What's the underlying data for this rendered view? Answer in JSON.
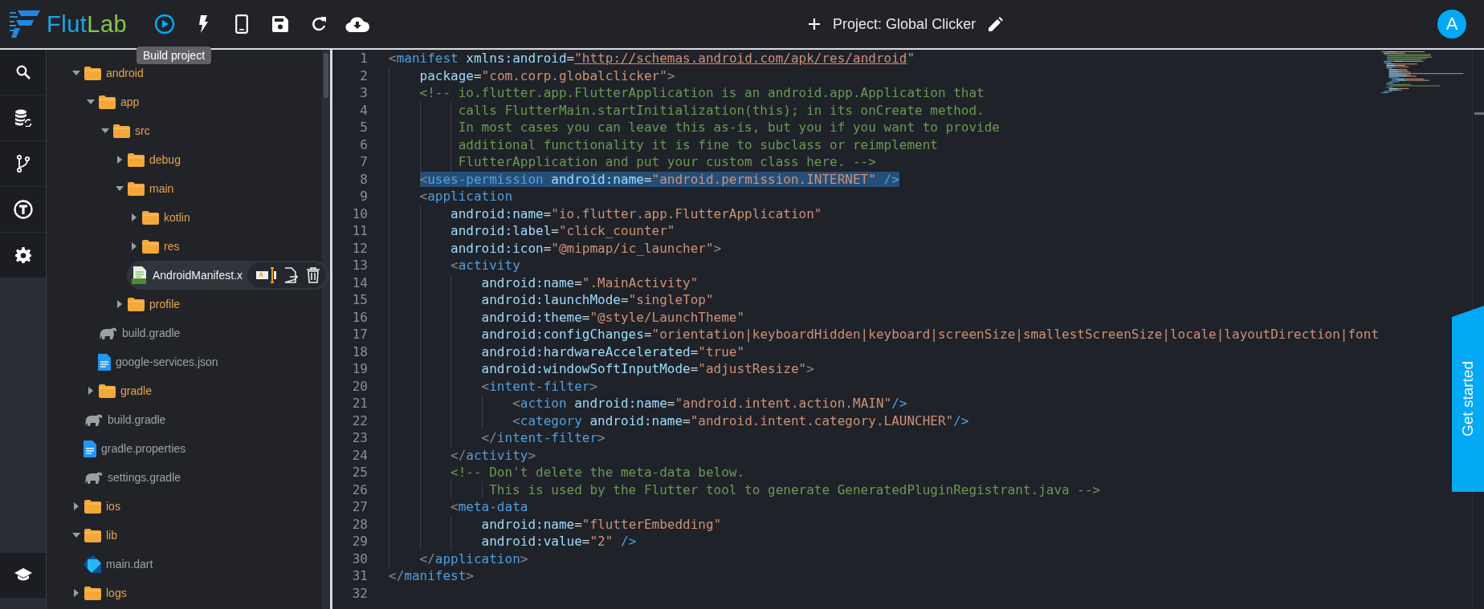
{
  "app": {
    "logo_first": "Flut",
    "logo_second": "Lab",
    "tooltip": "Build project",
    "project_title": "Project: Global Clicker",
    "avatar": "A",
    "get_started": "Get started"
  },
  "toolbar": [
    {
      "kind": "run"
    },
    {
      "kind": "bolt"
    },
    {
      "kind": "phone"
    },
    {
      "kind": "save"
    },
    {
      "kind": "refresh"
    },
    {
      "kind": "cloud"
    }
  ],
  "rail": [
    {
      "kind": "search"
    },
    {
      "kind": "database"
    },
    {
      "kind": "branch"
    },
    {
      "kind": "t"
    },
    {
      "kind": "gear"
    },
    {
      "kind": "school"
    }
  ],
  "tree": [
    {
      "name": "android",
      "kind": "folder",
      "expanded": true,
      "selected": false,
      "children": [
        {
          "name": "app",
          "kind": "folder",
          "expanded": true,
          "selected": false,
          "children": [
            {
              "name": "src",
              "kind": "folder",
              "expanded": true,
              "selected": false,
              "children": [
                {
                  "name": "debug",
                  "kind": "folder",
                  "expanded": false,
                  "selected": false
                },
                {
                  "name": "main",
                  "kind": "folder",
                  "expanded": true,
                  "selected": false,
                  "children": [
                    {
                      "name": "kotlin",
                      "kind": "folder",
                      "expanded": false,
                      "selected": false
                    },
                    {
                      "name": "res",
                      "kind": "folder",
                      "expanded": false,
                      "selected": false
                    },
                    {
                      "name": "AndroidManifest.x",
                      "kind": "xml",
                      "selected": true
                    }
                  ]
                },
                {
                  "name": "profile",
                  "kind": "folder",
                  "expanded": false,
                  "selected": false
                }
              ]
            },
            {
              "name": "build.gradle",
              "kind": "gradle",
              "selected": false
            },
            {
              "name": "google-services.json",
              "kind": "doc",
              "selected": false
            }
          ]
        },
        {
          "name": "gradle",
          "kind": "folder",
          "expanded": false,
          "selected": false
        },
        {
          "name": "build.gradle",
          "kind": "gradle",
          "selected": false
        },
        {
          "name": "gradle.properties",
          "kind": "doc",
          "selected": false
        },
        {
          "name": "settings.gradle",
          "kind": "gradle",
          "selected": false
        }
      ]
    },
    {
      "name": "ios",
      "kind": "folder",
      "expanded": false,
      "selected": false
    },
    {
      "name": "lib",
      "kind": "folder",
      "expanded": true,
      "selected": false,
      "children": [
        {
          "name": "main.dart",
          "kind": "dart",
          "selected": false
        }
      ]
    },
    {
      "name": "logs",
      "kind": "folder",
      "expanded": false,
      "selected": false
    }
  ],
  "editor": {
    "lines": [
      {
        "number": "1",
        "tokens": [
          {
            "kind": "p",
            "text": "<"
          },
          {
            "kind": "tag",
            "text": "manifest "
          },
          {
            "kind": "attr",
            "text": "xmlns:android"
          },
          {
            "kind": "eq",
            "text": "="
          },
          {
            "kind": "link",
            "text": "\"http://schemas.android.com/apk/res/android"
          },
          {
            "kind": "str",
            "text": "\""
          }
        ]
      },
      {
        "number": "2",
        "tokens": [
          {
            "kind": "attr",
            "text": "    package"
          },
          {
            "kind": "eq",
            "text": "="
          },
          {
            "kind": "str",
            "text": "\"com.corp.globalclicker\""
          },
          {
            "kind": "p",
            "text": ">"
          }
        ]
      },
      {
        "number": "3",
        "tokens": [
          {
            "kind": "comment",
            "text": "    <!-- io.flutter.app.FlutterApplication is an android.app.Application that"
          }
        ]
      },
      {
        "number": "4",
        "tokens": [
          {
            "kind": "comment",
            "text": "         calls FlutterMain.startInitialization(this); in its onCreate method."
          }
        ]
      },
      {
        "number": "5",
        "tokens": [
          {
            "kind": "comment",
            "text": "         In most cases you can leave this as-is, but you if you want to provide"
          }
        ]
      },
      {
        "number": "6",
        "tokens": [
          {
            "kind": "comment",
            "text": "         additional functionality it is fine to subclass or reimplement"
          }
        ]
      },
      {
        "number": "7",
        "tokens": [
          {
            "kind": "comment",
            "text": "         FlutterApplication and put your custom class here. -->"
          }
        ]
      },
      {
        "number": "8",
        "highlighted": true,
        "tokens": [
          {
            "kind": "p",
            "text": "    <"
          },
          {
            "kind": "tag",
            "text": "uses-permission "
          },
          {
            "kind": "attr",
            "text": "android:name"
          },
          {
            "kind": "eq",
            "text": "="
          },
          {
            "kind": "str",
            "text": "\"android.permission.INTERNET\""
          },
          {
            "kind": "tag",
            "text": " />"
          }
        ]
      },
      {
        "number": "9",
        "tokens": [
          {
            "kind": "p",
            "text": "    <"
          },
          {
            "kind": "tag",
            "text": "application"
          }
        ]
      },
      {
        "number": "10",
        "tokens": [
          {
            "kind": "attr",
            "text": "        android:name"
          },
          {
            "kind": "eq",
            "text": "="
          },
          {
            "kind": "str",
            "text": "\"io.flutter.app.FlutterApplication\""
          }
        ]
      },
      {
        "number": "11",
        "tokens": [
          {
            "kind": "attr",
            "text": "        android:label"
          },
          {
            "kind": "eq",
            "text": "="
          },
          {
            "kind": "str",
            "text": "\"click_counter\""
          }
        ]
      },
      {
        "number": "12",
        "tokens": [
          {
            "kind": "attr",
            "text": "        android:icon"
          },
          {
            "kind": "eq",
            "text": "="
          },
          {
            "kind": "str",
            "text": "\"@mipmap/ic_launcher\""
          },
          {
            "kind": "p",
            "text": ">"
          }
        ]
      },
      {
        "number": "13",
        "tokens": [
          {
            "kind": "p",
            "text": "        <"
          },
          {
            "kind": "tag",
            "text": "activity"
          }
        ]
      },
      {
        "number": "14",
        "tokens": [
          {
            "kind": "attr",
            "text": "            android:name"
          },
          {
            "kind": "eq",
            "text": "="
          },
          {
            "kind": "str",
            "text": "\".MainActivity\""
          }
        ]
      },
      {
        "number": "15",
        "tokens": [
          {
            "kind": "attr",
            "text": "            android:launchMode"
          },
          {
            "kind": "eq",
            "text": "="
          },
          {
            "kind": "str",
            "text": "\"singleTop\""
          }
        ]
      },
      {
        "number": "16",
        "tokens": [
          {
            "kind": "attr",
            "text": "            android:theme"
          },
          {
            "kind": "eq",
            "text": "="
          },
          {
            "kind": "str",
            "text": "\"@style/LaunchTheme\""
          }
        ]
      },
      {
        "number": "17",
        "tokens": [
          {
            "kind": "attr",
            "text": "            android:configChanges"
          },
          {
            "kind": "eq",
            "text": "="
          },
          {
            "kind": "str",
            "text": "\"orientation|keyboardHidden|keyboard|screenSize|smallestScreenSize|locale|layoutDirection|font"
          }
        ]
      },
      {
        "number": "18",
        "tokens": [
          {
            "kind": "attr",
            "text": "            android:hardwareAccelerated"
          },
          {
            "kind": "eq",
            "text": "="
          },
          {
            "kind": "str",
            "text": "\"true\""
          }
        ]
      },
      {
        "number": "19",
        "tokens": [
          {
            "kind": "attr",
            "text": "            android:windowSoftInputMode"
          },
          {
            "kind": "eq",
            "text": "="
          },
          {
            "kind": "str",
            "text": "\"adjustResize\""
          },
          {
            "kind": "p",
            "text": ">"
          }
        ]
      },
      {
        "number": "20",
        "tokens": [
          {
            "kind": "p",
            "text": "            <"
          },
          {
            "kind": "tag",
            "text": "intent-filter"
          },
          {
            "kind": "p",
            "text": ">"
          }
        ]
      },
      {
        "number": "21",
        "tokens": [
          {
            "kind": "p",
            "text": "                <"
          },
          {
            "kind": "tag",
            "text": "action "
          },
          {
            "kind": "attr",
            "text": "android:name"
          },
          {
            "kind": "eq",
            "text": "="
          },
          {
            "kind": "str",
            "text": "\"android.intent.action.MAIN\""
          },
          {
            "kind": "tag",
            "text": "/>"
          }
        ]
      },
      {
        "number": "22",
        "tokens": [
          {
            "kind": "p",
            "text": "                <"
          },
          {
            "kind": "tag",
            "text": "category "
          },
          {
            "kind": "attr",
            "text": "android:name"
          },
          {
            "kind": "eq",
            "text": "="
          },
          {
            "kind": "str",
            "text": "\"android.intent.category.LAUNCHER\""
          },
          {
            "kind": "tag",
            "text": "/>"
          }
        ]
      },
      {
        "number": "23",
        "tokens": [
          {
            "kind": "p",
            "text": "            </"
          },
          {
            "kind": "tag",
            "text": "intent-filter"
          },
          {
            "kind": "p",
            "text": ">"
          }
        ]
      },
      {
        "number": "24",
        "tokens": [
          {
            "kind": "p",
            "text": "        </"
          },
          {
            "kind": "tag",
            "text": "activity"
          },
          {
            "kind": "p",
            "text": ">"
          }
        ]
      },
      {
        "number": "25",
        "tokens": [
          {
            "kind": "comment",
            "text": "        <!-- Don't delete the meta-data below."
          }
        ]
      },
      {
        "number": "26",
        "tokens": [
          {
            "kind": "comment",
            "text": "             This is used by the Flutter tool to generate GeneratedPluginRegistrant.java -->"
          }
        ]
      },
      {
        "number": "27",
        "tokens": [
          {
            "kind": "p",
            "text": "        <"
          },
          {
            "kind": "tag",
            "text": "meta-data"
          }
        ]
      },
      {
        "number": "28",
        "tokens": [
          {
            "kind": "attr",
            "text": "            android:name"
          },
          {
            "kind": "eq",
            "text": "="
          },
          {
            "kind": "str",
            "text": "\"flutterEmbedding\""
          }
        ]
      },
      {
        "number": "29",
        "tokens": [
          {
            "kind": "attr",
            "text": "            android:value"
          },
          {
            "kind": "eq",
            "text": "="
          },
          {
            "kind": "str",
            "text": "\"2\""
          },
          {
            "kind": "tag",
            "text": " />"
          }
        ]
      },
      {
        "number": "30",
        "tokens": [
          {
            "kind": "p",
            "text": "    </"
          },
          {
            "kind": "tag",
            "text": "application"
          },
          {
            "kind": "p",
            "text": ">"
          }
        ]
      },
      {
        "number": "31",
        "tokens": [
          {
            "kind": "p",
            "text": "</"
          },
          {
            "kind": "tag",
            "text": "manifest"
          },
          {
            "kind": "p",
            "text": ">"
          }
        ]
      },
      {
        "number": "32"
      }
    ]
  }
}
